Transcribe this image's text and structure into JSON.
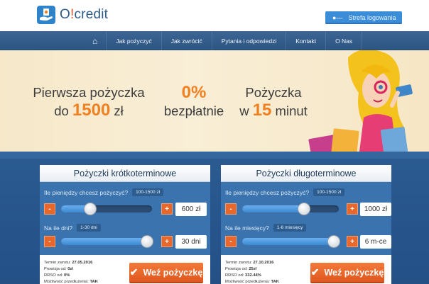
{
  "header": {
    "brand_main": "O",
    "brand_bang": "!",
    "brand_rest": "credit",
    "login_label": "Strefa logowania",
    "login_icon": "key-icon"
  },
  "nav": {
    "home_icon": "home-icon",
    "items": [
      {
        "label": "Jak pożyczyć"
      },
      {
        "label": "Jak zwrócić"
      },
      {
        "label": "Pytania i odpowiedzi"
      },
      {
        "label": "Kontakt"
      },
      {
        "label": "O Nas"
      }
    ]
  },
  "banner": {
    "col1_line1": "Pierwsza pożyczka",
    "col1_pre": "do ",
    "col1_amount": "1500",
    "col1_post": " zł",
    "col2_pct": "0%",
    "col2_line2": "bezpłatnie",
    "col3_line1": "Pożyczka",
    "col3_pre": "w ",
    "col3_num": "15",
    "col3_post": " minut"
  },
  "short_loan": {
    "title": "Pożyczki krótkoterminowe",
    "amount_question": "Ile pieniędzy chcesz pożyczyć?",
    "amount_range": "100-1500 zł",
    "amount_value": "600 zł",
    "amount_fill": 0.32,
    "days_question": "Na ile dni?",
    "days_range": "1-30 dni",
    "days_value": "30 dni",
    "days_fill": 1.0,
    "return_label": "Termin zwrotu: ",
    "return_value": "27.05.2016",
    "fee_label": "Prowizja od: ",
    "fee_value": "0zł",
    "rrso_label": "RRSO od: ",
    "rrso_value": "0%",
    "extend_label": "Możliwość przedłużenia: ",
    "extend_value": "TAK",
    "cta_label": "Weź pożyczkę"
  },
  "long_loan": {
    "title": "Pożyczki długoterminowe",
    "amount_question": "Ile pieniędzy chcesz pożyczyć?",
    "amount_range": "100-1500 zł",
    "amount_value": "1000 zł",
    "amount_fill": 0.64,
    "months_question": "Na ile miesięcy?",
    "months_range": "1-6 miesięcy",
    "months_value": "6 m-ce",
    "months_fill": 1.0,
    "return_label": "Termin zwrotu: ",
    "return_value": "27.10.2016",
    "fee_label": "Prowizja od: ",
    "fee_value": "25zł",
    "rrso_label": "RRSO od: ",
    "rrso_value": "332.44%",
    "extend_label": "Możliwość przedłużenia: ",
    "extend_value": "TAK",
    "cta_label": "Weź pożyczkę"
  },
  "colors": {
    "accent": "#f08020",
    "brand_blue": "#2f83c9",
    "nav": "#33598a",
    "cta": "#e8672a"
  }
}
